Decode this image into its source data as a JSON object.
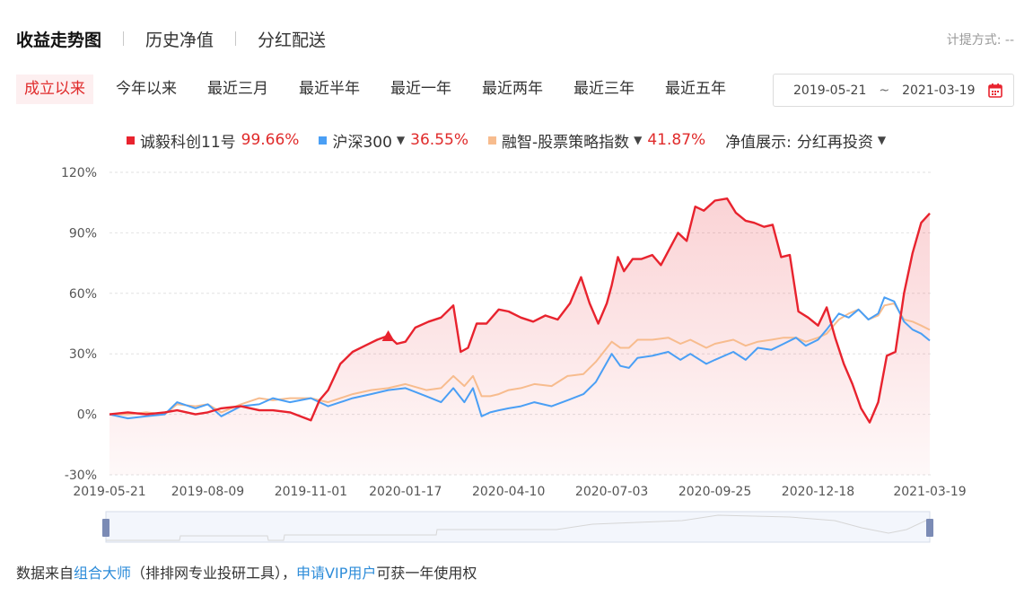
{
  "tabs": [
    {
      "label": "收益走势图",
      "active": true
    },
    {
      "label": "历史净值",
      "active": false
    },
    {
      "label": "分红配送",
      "active": false
    }
  ],
  "method": {
    "label": "计提方式:",
    "value": "--"
  },
  "ranges": [
    {
      "label": "成立以来",
      "active": true
    },
    {
      "label": "今年以来",
      "active": false
    },
    {
      "label": "最近三月",
      "active": false
    },
    {
      "label": "最近半年",
      "active": false
    },
    {
      "label": "最近一年",
      "active": false
    },
    {
      "label": "最近两年",
      "active": false
    },
    {
      "label": "最近三年",
      "active": false
    },
    {
      "label": "最近五年",
      "active": false
    }
  ],
  "date_range": {
    "start": "2019-05-21",
    "separator": "~",
    "end": "2021-03-19"
  },
  "legend": {
    "items": [
      {
        "name": "诚毅科创11号",
        "value": "99.66%",
        "color": "#e8232e",
        "dropdown": false
      },
      {
        "name": "沪深300",
        "value": "36.55%",
        "color": "#4a9ff5",
        "dropdown": true
      },
      {
        "name": "融智-股票策略指数",
        "value": "41.87%",
        "color": "#f7bc8e",
        "dropdown": true
      }
    ],
    "display_label": "净值展示:",
    "display_value": "分红再投资"
  },
  "chart_data": {
    "type": "line",
    "ylim": [
      -30,
      120
    ],
    "y_ticks": [
      "120%",
      "90%",
      "60%",
      "30%",
      "0%",
      "-30%"
    ],
    "y_tick_values": [
      120,
      90,
      60,
      30,
      0,
      -30
    ],
    "x_start": "2019-05-21",
    "x_end": "2021-03-19",
    "x_ticks": [
      "2019-05-21",
      "2019-08-09",
      "2019-11-01",
      "2020-01-17",
      "2020-04-10",
      "2020-07-03",
      "2020-09-25",
      "2020-12-18",
      "2021-03-19"
    ],
    "grid": true,
    "marker": {
      "date": "2020-01-03",
      "value": 39
    },
    "series": [
      {
        "name": "诚毅科创11号",
        "color": "#e8232e",
        "fill": true,
        "x": [
          "2019-05-21",
          "2019-06-05",
          "2019-06-20",
          "2019-07-05",
          "2019-07-15",
          "2019-07-30",
          "2019-08-09",
          "2019-08-20",
          "2019-09-05",
          "2019-09-20",
          "2019-10-01",
          "2019-10-15",
          "2019-11-01",
          "2019-11-08",
          "2019-11-15",
          "2019-11-25",
          "2019-12-05",
          "2019-12-15",
          "2019-12-25",
          "2020-01-03",
          "2020-01-10",
          "2020-01-17",
          "2020-01-25",
          "2020-02-05",
          "2020-02-15",
          "2020-02-25",
          "2020-03-02",
          "2020-03-08",
          "2020-03-15",
          "2020-03-23",
          "2020-04-02",
          "2020-04-10",
          "2020-04-20",
          "2020-04-30",
          "2020-05-10",
          "2020-05-20",
          "2020-05-30",
          "2020-06-08",
          "2020-06-15",
          "2020-06-22",
          "2020-06-29",
          "2020-07-03",
          "2020-07-08",
          "2020-07-13",
          "2020-07-20",
          "2020-07-27",
          "2020-08-05",
          "2020-08-12",
          "2020-08-19",
          "2020-08-26",
          "2020-09-02",
          "2020-09-09",
          "2020-09-16",
          "2020-09-25",
          "2020-10-05",
          "2020-10-12",
          "2020-10-20",
          "2020-10-27",
          "2020-11-04",
          "2020-11-11",
          "2020-11-18",
          "2020-11-25",
          "2020-12-02",
          "2020-12-10",
          "2020-12-18",
          "2020-12-25",
          "2021-01-01",
          "2021-01-08",
          "2021-01-15",
          "2021-01-22",
          "2021-01-29",
          "2021-02-05",
          "2021-02-12",
          "2021-02-19",
          "2021-02-26",
          "2021-03-05",
          "2021-03-12",
          "2021-03-19"
        ],
        "y": [
          0,
          1,
          0,
          1,
          2,
          0,
          1,
          3,
          4,
          2,
          2,
          1,
          -3,
          7,
          12,
          25,
          31,
          34,
          37,
          39,
          35,
          36,
          43,
          46,
          48,
          54,
          31,
          33,
          45,
          45,
          52,
          51,
          48,
          46,
          49,
          47,
          55,
          68,
          55,
          45,
          55,
          64,
          78,
          71,
          77,
          77,
          79,
          74,
          82,
          90,
          86,
          103,
          101,
          106,
          107,
          100,
          96,
          95,
          93,
          94,
          78,
          79,
          51,
          48,
          44,
          53,
          38,
          25,
          15,
          3,
          -4,
          6,
          29,
          31,
          60,
          80,
          95,
          99.66
        ]
      },
      {
        "name": "沪深300",
        "color": "#4a9ff5",
        "fill": false,
        "x": [
          "2019-05-21",
          "2019-06-05",
          "2019-06-20",
          "2019-07-05",
          "2019-07-15",
          "2019-07-30",
          "2019-08-09",
          "2019-08-20",
          "2019-09-05",
          "2019-09-20",
          "2019-10-01",
          "2019-10-15",
          "2019-11-01",
          "2019-11-15",
          "2019-12-05",
          "2019-12-20",
          "2020-01-03",
          "2020-01-17",
          "2020-02-03",
          "2020-02-15",
          "2020-02-25",
          "2020-03-05",
          "2020-03-12",
          "2020-03-19",
          "2020-03-26",
          "2020-04-02",
          "2020-04-10",
          "2020-04-20",
          "2020-05-01",
          "2020-05-15",
          "2020-05-28",
          "2020-06-10",
          "2020-06-20",
          "2020-07-03",
          "2020-07-10",
          "2020-07-17",
          "2020-07-24",
          "2020-08-05",
          "2020-08-18",
          "2020-08-28",
          "2020-09-05",
          "2020-09-18",
          "2020-09-25",
          "2020-10-10",
          "2020-10-20",
          "2020-10-30",
          "2020-11-10",
          "2020-11-20",
          "2020-11-30",
          "2020-12-08",
          "2020-12-18",
          "2020-12-25",
          "2021-01-04",
          "2021-01-12",
          "2021-01-20",
          "2021-01-28",
          "2021-02-05",
          "2021-02-10",
          "2021-02-18",
          "2021-02-26",
          "2021-03-05",
          "2021-03-12",
          "2021-03-19"
        ],
        "y": [
          0,
          -2,
          -1,
          0,
          6,
          3,
          5,
          -1,
          4,
          5,
          8,
          6,
          8,
          4,
          8,
          10,
          12,
          13,
          9,
          6,
          13,
          6,
          13,
          -1,
          1,
          2,
          3,
          4,
          6,
          4,
          7,
          10,
          16,
          30,
          24,
          23,
          28,
          29,
          31,
          27,
          30,
          25,
          27,
          31,
          27,
          33,
          32,
          35,
          38,
          34,
          37,
          42,
          50,
          48,
          52,
          47,
          50,
          58,
          56,
          46,
          42,
          40,
          36.55
        ]
      },
      {
        "name": "融智-股票策略指数",
        "color": "#f7bc8e",
        "fill": false,
        "x": [
          "2019-05-21",
          "2019-06-05",
          "2019-06-20",
          "2019-07-05",
          "2019-07-15",
          "2019-07-30",
          "2019-08-09",
          "2019-08-20",
          "2019-09-05",
          "2019-09-20",
          "2019-10-01",
          "2019-10-15",
          "2019-11-01",
          "2019-11-15",
          "2019-12-05",
          "2019-12-20",
          "2020-01-03",
          "2020-01-17",
          "2020-02-03",
          "2020-02-15",
          "2020-02-25",
          "2020-03-05",
          "2020-03-12",
          "2020-03-19",
          "2020-03-26",
          "2020-04-02",
          "2020-04-10",
          "2020-04-20",
          "2020-05-01",
          "2020-05-15",
          "2020-05-28",
          "2020-06-10",
          "2020-06-20",
          "2020-07-03",
          "2020-07-10",
          "2020-07-17",
          "2020-07-24",
          "2020-08-05",
          "2020-08-18",
          "2020-08-28",
          "2020-09-05",
          "2020-09-18",
          "2020-09-25",
          "2020-10-10",
          "2020-10-20",
          "2020-10-30",
          "2020-11-10",
          "2020-11-20",
          "2020-11-30",
          "2020-12-08",
          "2020-12-18",
          "2020-12-25",
          "2021-01-04",
          "2021-01-12",
          "2021-01-20",
          "2021-01-28",
          "2021-02-05",
          "2021-02-10",
          "2021-02-18",
          "2021-02-26",
          "2021-03-05",
          "2021-03-12",
          "2021-03-19"
        ],
        "y": [
          0,
          0,
          1,
          0,
          5,
          4,
          5,
          1,
          5,
          8,
          7,
          8,
          8,
          6,
          10,
          12,
          13,
          15,
          12,
          13,
          19,
          14,
          19,
          9,
          9,
          10,
          12,
          13,
          15,
          14,
          19,
          20,
          26,
          36,
          33,
          33,
          37,
          37,
          38,
          35,
          37,
          33,
          35,
          37,
          34,
          36,
          37,
          38,
          38,
          36,
          38,
          40,
          47,
          50,
          52,
          47,
          49,
          54,
          55,
          47,
          46,
          44,
          41.87
        ]
      }
    ]
  },
  "footer": {
    "prefix": "数据来自",
    "link1": "组合大师",
    "middle": "（排排网专业投研工具），",
    "link2": "申请VIP用户",
    "suffix": "可获一年使用权"
  }
}
